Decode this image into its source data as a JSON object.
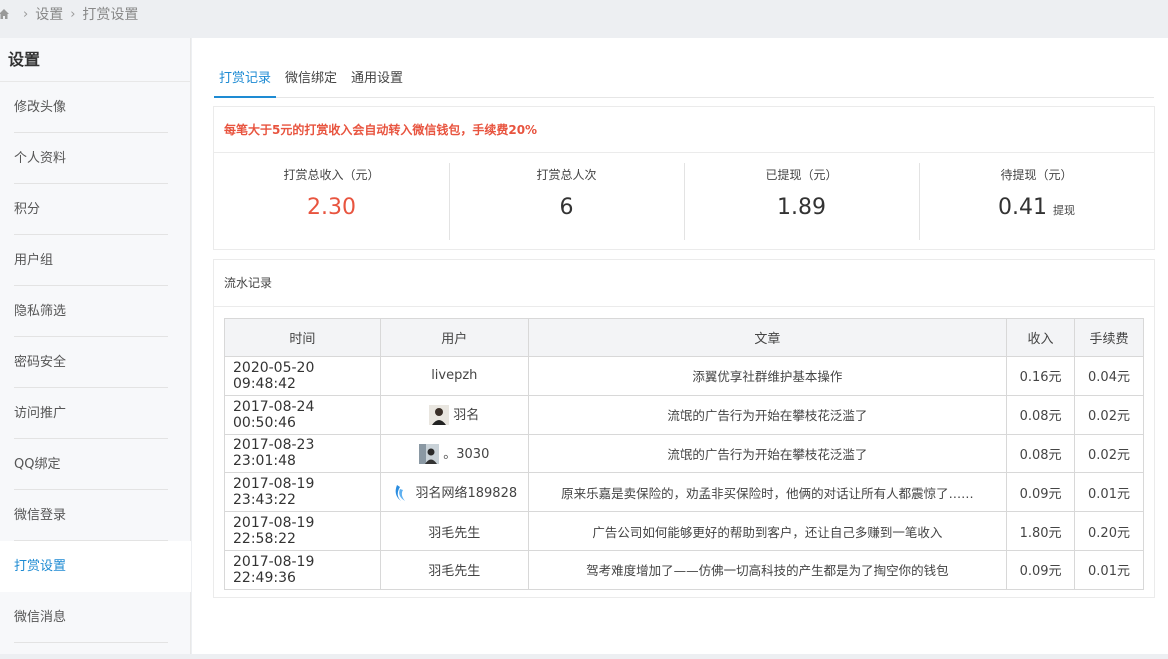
{
  "breadcrumb": {
    "items": [
      "设置",
      "打赏设置"
    ]
  },
  "sidebar": {
    "title": "设置",
    "items": [
      {
        "label": "修改头像"
      },
      {
        "label": "个人资料"
      },
      {
        "label": "积分"
      },
      {
        "label": "用户组"
      },
      {
        "label": "隐私筛选"
      },
      {
        "label": "密码安全"
      },
      {
        "label": "访问推广"
      },
      {
        "label": "QQ绑定"
      },
      {
        "label": "微信登录"
      },
      {
        "label": "打赏设置"
      },
      {
        "label": "微信消息"
      }
    ],
    "active_index": 9
  },
  "tabs": [
    {
      "label": "打赏记录"
    },
    {
      "label": "微信绑定"
    },
    {
      "label": "通用设置"
    }
  ],
  "notice": "每笔大于5元的打赏收入会自动转入微信钱包，手续费20%",
  "stats": {
    "total_income": {
      "label": "打赏总收入（元）",
      "value": "2.30"
    },
    "total_count": {
      "label": "打赏总人次",
      "value": "6"
    },
    "withdrawn": {
      "label": "已提现（元）",
      "value": "1.89"
    },
    "pending": {
      "label": "待提现（元）",
      "value": "0.41",
      "action": "提现"
    }
  },
  "records": {
    "title": "流水记录",
    "columns": [
      "时间",
      "用户",
      "文章",
      "收入",
      "手续费"
    ],
    "rows": [
      {
        "time": "2020-05-20 09:48:42",
        "user": "livepzh",
        "article": "添翼优享社群维护基本操作",
        "income": "0.16元",
        "fee": "0.04元"
      },
      {
        "time": "2017-08-24 00:50:46",
        "user": "羽名",
        "article": "流氓的广告行为开始在攀枝花泛滥了",
        "income": "0.08元",
        "fee": "0.02元"
      },
      {
        "time": "2017-08-23 23:01:48",
        "user": "。3030",
        "article": "流氓的广告行为开始在攀枝花泛滥了",
        "income": "0.08元",
        "fee": "0.02元"
      },
      {
        "time": "2017-08-19 23:43:22",
        "user": "羽名网络189828",
        "article": "原来乐嘉是卖保险的，劝孟非买保险时，他俩的对话让所有人都震惊了……",
        "income": "0.09元",
        "fee": "0.01元"
      },
      {
        "time": "2017-08-19 22:58:22",
        "user": "羽毛先生",
        "article": "广告公司如何能够更好的帮助到客户，还让自己多赚到一笔收入",
        "income": "1.80元",
        "fee": "0.20元"
      },
      {
        "time": "2017-08-19 22:49:36",
        "user": "羽毛先生",
        "article": "驾考难度增加了——仿佛一切高科技的产生都是为了掏空你的钱包",
        "income": "0.09元",
        "fee": "0.01元"
      }
    ]
  },
  "colors": {
    "accent": "#1e8bd3",
    "highlight": "#e8543f"
  }
}
